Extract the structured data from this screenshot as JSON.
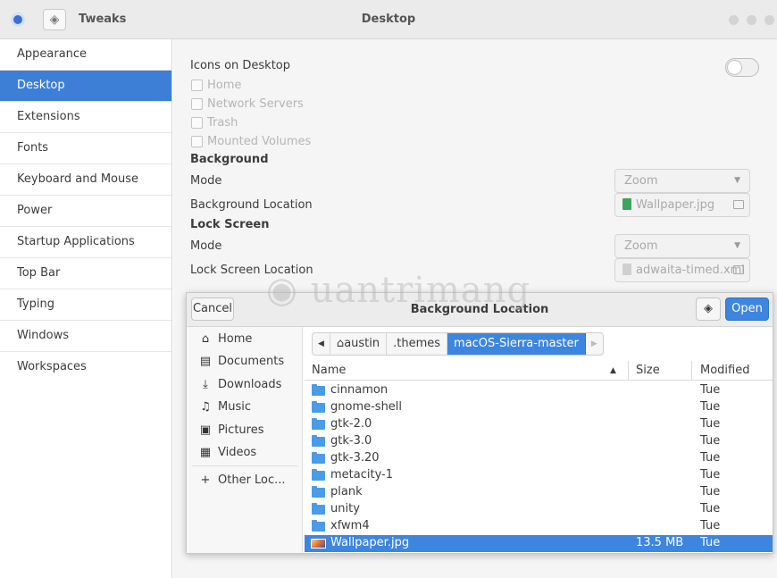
{
  "window": {
    "app_title": "Tweaks",
    "page_title": "Desktop",
    "icon": "tweaks-app-icon",
    "search_icon": "search-icon"
  },
  "sidebar": {
    "items": [
      {
        "label": "Appearance"
      },
      {
        "label": "Desktop",
        "active": true
      },
      {
        "label": "Extensions"
      },
      {
        "label": "Fonts"
      },
      {
        "label": "Keyboard and Mouse"
      },
      {
        "label": "Power"
      },
      {
        "label": "Startup Applications"
      },
      {
        "label": "Top Bar"
      },
      {
        "label": "Typing"
      },
      {
        "label": "Windows"
      },
      {
        "label": "Workspaces"
      }
    ]
  },
  "desktop": {
    "icons_on_desktop_label": "Icons on Desktop",
    "icons_on_desktop_enabled": false,
    "checkboxes": [
      {
        "label": "Home",
        "checked": false
      },
      {
        "label": "Network Servers",
        "checked": false
      },
      {
        "label": "Trash",
        "checked": false
      },
      {
        "label": "Mounted Volumes",
        "checked": false
      }
    ],
    "background_heading": "Background",
    "background_mode_label": "Mode",
    "background_mode_value": "Zoom",
    "background_location_label": "Background Location",
    "background_location_value": "Wallpaper.jpg",
    "lock_screen_heading": "Lock Screen",
    "lock_mode_label": "Mode",
    "lock_mode_value": "Zoom",
    "lock_location_label": "Lock Screen Location",
    "lock_location_value": "adwaita-timed.xml"
  },
  "dialog": {
    "title": "Background Location",
    "cancel_label": "Cancel",
    "open_label": "Open",
    "places": [
      {
        "label": "Home",
        "icon": "home-icon"
      },
      {
        "label": "Documents",
        "icon": "document-icon"
      },
      {
        "label": "Downloads",
        "icon": "download-icon"
      },
      {
        "label": "Music",
        "icon": "music-icon"
      },
      {
        "label": "Pictures",
        "icon": "picture-icon"
      },
      {
        "label": "Videos",
        "icon": "video-icon"
      }
    ],
    "other_locations_label": "Other Loc...",
    "path": [
      "austin",
      ".themes",
      "macOS-Sierra-master"
    ],
    "columns": {
      "name": "Name",
      "size": "Size",
      "modified": "Modified"
    },
    "files": [
      {
        "name": "cinnamon",
        "type": "folder",
        "size": "",
        "modified": "Tue"
      },
      {
        "name": "gnome-shell",
        "type": "folder",
        "size": "",
        "modified": "Tue"
      },
      {
        "name": "gtk-2.0",
        "type": "folder",
        "size": "",
        "modified": "Tue"
      },
      {
        "name": "gtk-3.0",
        "type": "folder",
        "size": "",
        "modified": "Tue"
      },
      {
        "name": "gtk-3.20",
        "type": "folder",
        "size": "",
        "modified": "Tue"
      },
      {
        "name": "metacity-1",
        "type": "folder",
        "size": "",
        "modified": "Tue"
      },
      {
        "name": "plank",
        "type": "folder",
        "size": "",
        "modified": "Tue"
      },
      {
        "name": "unity",
        "type": "folder",
        "size": "",
        "modified": "Tue"
      },
      {
        "name": "xfwm4",
        "type": "folder",
        "size": "",
        "modified": "Tue"
      },
      {
        "name": "Wallpaper.jpg",
        "type": "image",
        "size": "13.5 MB",
        "modified": "Tue",
        "selected": true
      }
    ]
  },
  "watermark": "Quantrimang",
  "colors": {
    "accent": "#3d86e0",
    "sidebar_active": "#3d7fd6",
    "folder": "#4a9be8"
  }
}
